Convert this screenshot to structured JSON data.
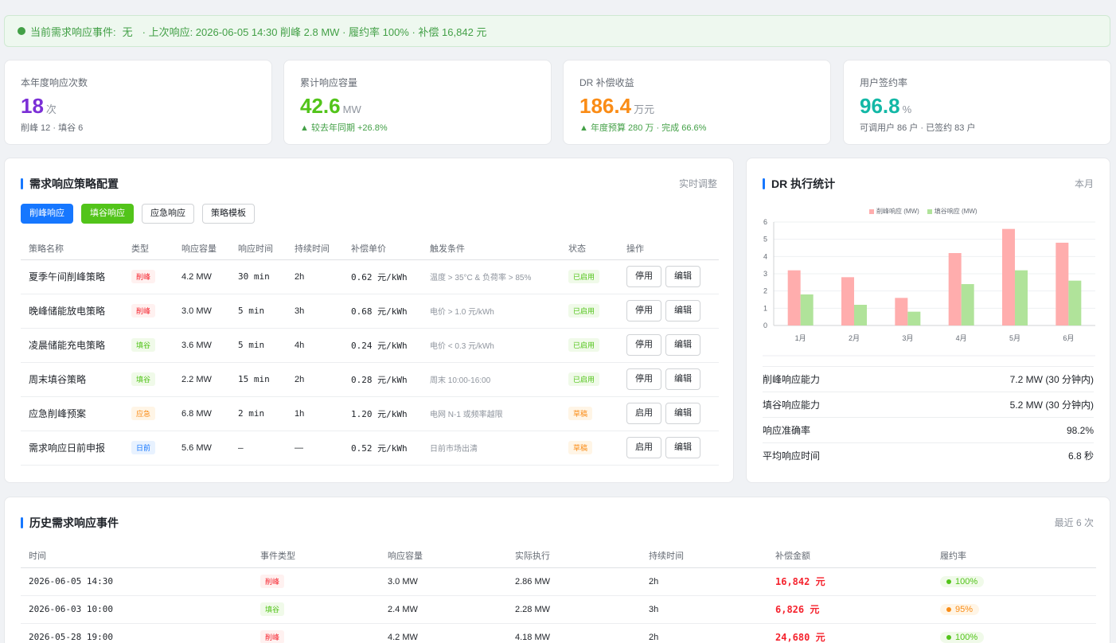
{
  "banner": {
    "label": "当前需求响应事件:",
    "value": "无",
    "last": "· 上次响应: 2026-06-05 14:30 削峰 2.8 MW · 履约率 100% · 补偿 16,842 元",
    "color": "#43a047"
  },
  "kpis": [
    {
      "title": "本年度响应次数",
      "value": "18",
      "unit": "次",
      "sub": "削峰 12 · 填谷 6",
      "color": "#7b2fd6"
    },
    {
      "title": "累计响应容量",
      "value": "42.6",
      "unit": "MW",
      "sub": "▲ 较去年同期 +26.8%",
      "color": "#52c41a"
    },
    {
      "title": "DR 补偿收益",
      "value": "186.4",
      "unit": "万元",
      "sub": "▲ 年度预算 280 万 · 完成 66.6%",
      "color": "#fa8c16"
    },
    {
      "title": "用户签约率",
      "value": "96.8",
      "unit": "%",
      "sub": "可调用户 86 户 · 已签约 83 户",
      "color": "#13b8a6"
    }
  ],
  "strategy": {
    "title": "需求响应策略配置",
    "right": "实时调整",
    "tabs": [
      "削峰响应",
      "填谷响应",
      "应急响应",
      "策略模板"
    ],
    "headers": [
      "策略名称",
      "类型",
      "响应容量",
      "响应时间",
      "持续时间",
      "补偿单价",
      "触发条件",
      "状态",
      "操作"
    ],
    "rows": [
      {
        "name": "夏季午间削峰策略",
        "type": "削峰",
        "cap": "4.2 MW",
        "resp": "30 min",
        "dur": "2h",
        "price": "0.62 元/kWh",
        "cond": "温度 > 35°C & 负荷率 > 85%",
        "status": "已启用",
        "act1": "停用",
        "act2": "编辑"
      },
      {
        "name": "晚峰储能放电策略",
        "type": "削峰",
        "cap": "3.0 MW",
        "resp": "5 min",
        "dur": "3h",
        "price": "0.68 元/kWh",
        "cond": "电价 > 1.0 元/kWh",
        "status": "已启用",
        "act1": "停用",
        "act2": "编辑"
      },
      {
        "name": "凌晨储能充电策略",
        "type": "填谷",
        "cap": "3.6 MW",
        "resp": "5 min",
        "dur": "4h",
        "price": "0.24 元/kWh",
        "cond": "电价 < 0.3 元/kWh",
        "status": "已启用",
        "act1": "停用",
        "act2": "编辑"
      },
      {
        "name": "周末填谷策略",
        "type": "填谷",
        "cap": "2.2 MW",
        "resp": "15 min",
        "dur": "2h",
        "price": "0.28 元/kWh",
        "cond": "周末 10:00-16:00",
        "status": "已启用",
        "act1": "停用",
        "act2": "编辑"
      },
      {
        "name": "应急削峰预案",
        "type": "应急",
        "cap": "6.8 MW",
        "resp": "2 min",
        "dur": "1h",
        "price": "1.20 元/kWh",
        "cond": "电网 N-1 或频率越限",
        "status": "草稿",
        "act1": "启用",
        "act2": "编辑"
      },
      {
        "name": "需求响应日前申报",
        "type": "日前",
        "cap": "5.6 MW",
        "resp": "—",
        "dur": "—",
        "price": "0.52 元/kWh",
        "cond": "日前市场出清",
        "status": "草稿",
        "act1": "启用",
        "act2": "编辑"
      }
    ]
  },
  "stats": {
    "title": "DR 执行统计",
    "right": "本月",
    "rows": [
      {
        "label": "削峰响应能力",
        "value": "7.2 MW (30 分钟内)"
      },
      {
        "label": "填谷响应能力",
        "value": "5.2 MW (30 分钟内)"
      },
      {
        "label": "响应准确率",
        "value": "98.2%"
      },
      {
        "label": "平均响应时间",
        "value": "6.8 秒"
      }
    ]
  },
  "chart_data": {
    "type": "bar",
    "categories": [
      "1月",
      "2月",
      "3月",
      "4月",
      "5月",
      "6月"
    ],
    "series": [
      {
        "name": "削峰响应 (MW)",
        "values": [
          3.2,
          2.8,
          1.6,
          4.2,
          5.6,
          4.8
        ],
        "color": "#ffadad"
      },
      {
        "name": "填谷响应 (MW)",
        "values": [
          1.8,
          1.2,
          0.8,
          2.4,
          3.2,
          2.6
        ],
        "color": "#b0e39a"
      }
    ],
    "ylim": [
      0,
      6
    ],
    "yticks": [
      "0",
      "1",
      "2",
      "3",
      "4",
      "5",
      "6"
    ],
    "grid": true,
    "legend": "top"
  },
  "history": {
    "title": "历史需求响应事件",
    "right": "最近 6 次",
    "headers": [
      "时间",
      "事件类型",
      "响应容量",
      "实际执行",
      "持续时间",
      "补偿金额",
      "履约率"
    ],
    "rows": [
      {
        "time": "2026-06-05 14:30",
        "type": "削峰",
        "cap": "3.0 MW",
        "actual": "2.86 MW",
        "dur": "2h",
        "amount": "16,842 元",
        "rate": "100%"
      },
      {
        "time": "2026-06-03 10:00",
        "type": "填谷",
        "cap": "2.4 MW",
        "actual": "2.28 MW",
        "dur": "3h",
        "amount": "6,826 元",
        "rate": "95%"
      },
      {
        "time": "2026-05-28 19:00",
        "type": "削峰",
        "cap": "4.2 MW",
        "actual": "4.18 MW",
        "dur": "2h",
        "amount": "24,680 元",
        "rate": "100%"
      }
    ]
  }
}
